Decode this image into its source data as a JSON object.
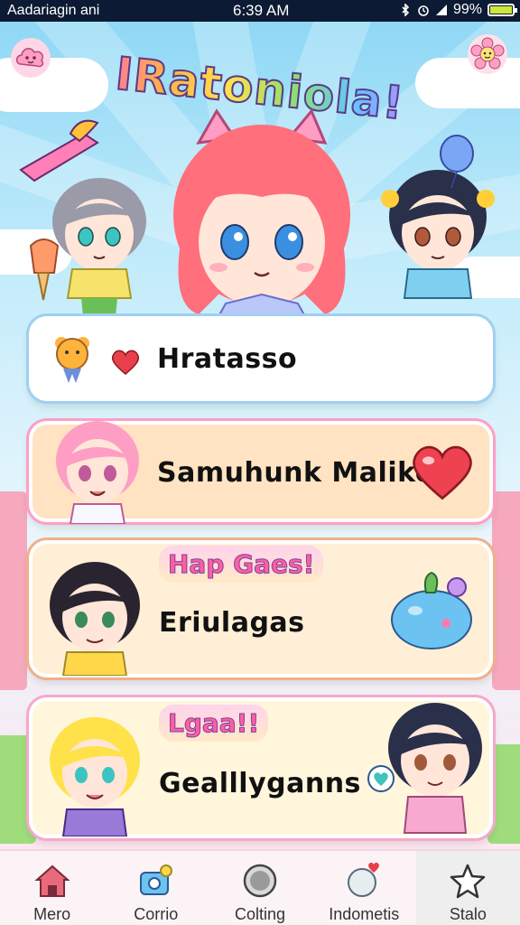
{
  "status_bar": {
    "carrier": "Aadariagin ani",
    "time": "6:39 AM",
    "battery": "99%",
    "battery_level": 0.99
  },
  "header": {
    "title": "IRatoniola!",
    "left_icon": "cloud-face-icon",
    "right_icon": "flower-face-icon"
  },
  "cards": [
    {
      "label": "Hratasso",
      "icons": [
        "bear-badge-icon",
        "heart-icon"
      ],
      "bg": "#ffffff"
    },
    {
      "label": "Samuhunk Malikes",
      "icons": [
        "heart-icon"
      ],
      "bg": "#ffe3c2"
    },
    {
      "badge": "Hap Gaes!",
      "label": "Eriulagas",
      "icons": [
        "blue-blob-icon"
      ],
      "bg": "#ffefd6"
    },
    {
      "badge": "Lgaa!!",
      "label": "Gealllyganns",
      "icons": [
        "heart-bubble-icon"
      ],
      "bg": "#fff6dc"
    }
  ],
  "nav": [
    {
      "label": "Mero",
      "icon": "home-icon"
    },
    {
      "label": "Corrio",
      "icon": "camera-icon"
    },
    {
      "label": "Colting",
      "icon": "circle-icon"
    },
    {
      "label": "Indometis",
      "icon": "heart-chat-icon"
    },
    {
      "label": "Stalo",
      "icon": "star-icon",
      "active": true
    }
  ],
  "colors": {
    "accent_pink": "#ff5fa0",
    "accent_purple": "#7b3fa0",
    "heart_red": "#e8404a"
  }
}
